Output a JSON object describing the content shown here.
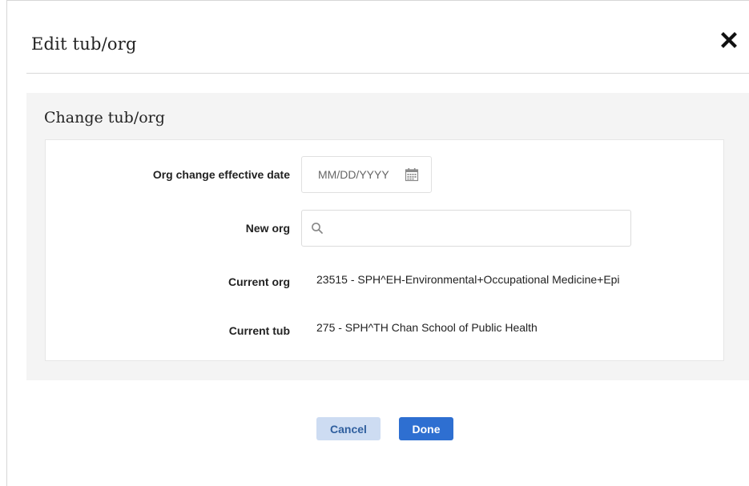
{
  "dialog": {
    "title": "Edit tub/org",
    "close_icon": "close-icon"
  },
  "section": {
    "title": "Change tub/org"
  },
  "form": {
    "effective_date": {
      "label": "Org change effective date",
      "placeholder": "MM/DD/YYYY",
      "icon": "calendar-icon"
    },
    "new_org": {
      "label": "New org",
      "value": "",
      "icon": "search-icon"
    },
    "current_org": {
      "label": "Current org",
      "value": "23515 - SPH^EH-Environmental+Occupational Medicine+Epi"
    },
    "current_tub": {
      "label": "Current tub",
      "value": "275 - SPH^TH Chan School of Public Health"
    }
  },
  "actions": {
    "cancel_label": "Cancel",
    "done_label": "Done"
  },
  "colors": {
    "primary": "#2e6fd1",
    "secondary_bg": "#cddcf2",
    "section_bg": "#f4f4f4"
  }
}
